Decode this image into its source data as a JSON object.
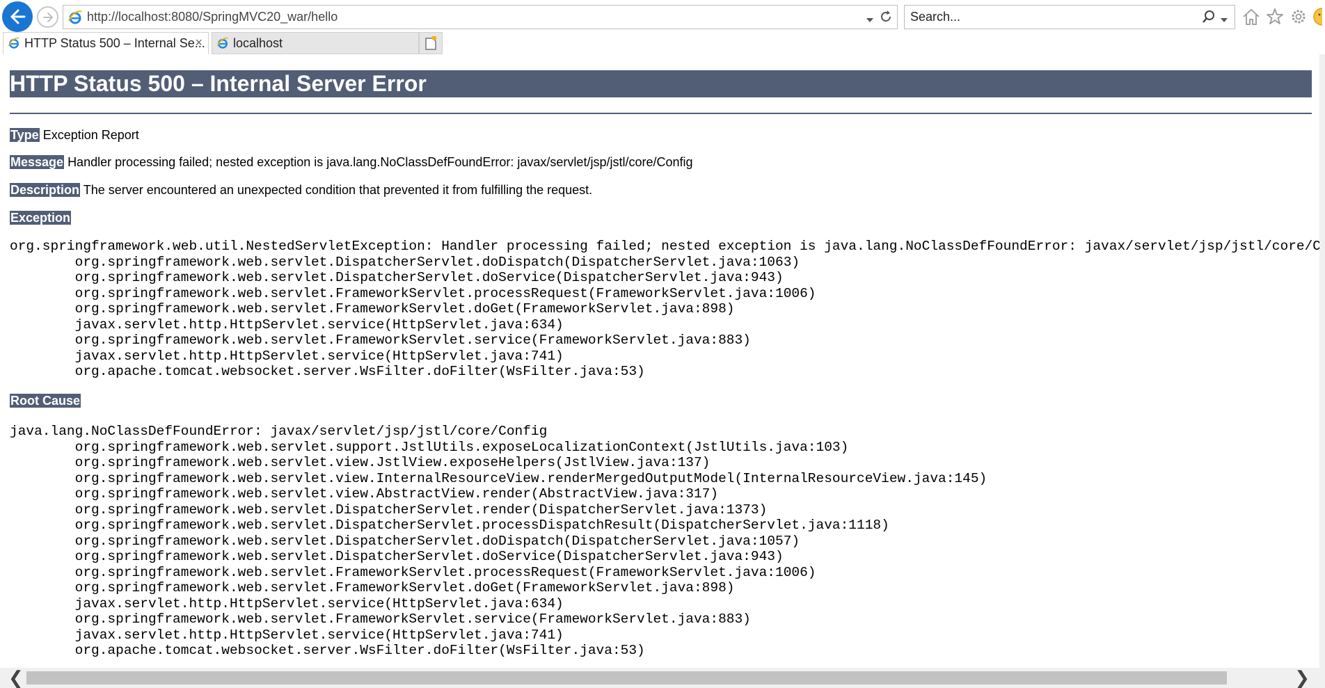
{
  "browser": {
    "url": "http://localhost:8080/SpringMVC20_war/hello",
    "search_placeholder": "Search...",
    "tabs": [
      {
        "label": "HTTP Status 500 – Internal Se...",
        "active": true
      },
      {
        "label": "localhost",
        "active": false
      }
    ],
    "tab_close": "×",
    "icons": [
      "back-arrow-icon",
      "forward-arrow-icon",
      "ie-logo-icon",
      "dropdown-icon",
      "refresh-icon",
      "search-icon",
      "home-icon",
      "favorites-star-icon",
      "settings-gear-icon",
      "smiley-feedback-icon",
      "new-tab-icon"
    ],
    "accent_color": "#1976d2"
  },
  "page": {
    "heading": "HTTP Status 500 – Internal Server Error",
    "header_color": "#525d76",
    "type": {
      "label": "Type",
      "value": "Exception Report"
    },
    "message": {
      "label": "Message",
      "value": "Handler processing failed; nested exception is java.lang.NoClassDefFoundError: javax/servlet/jsp/jstl/core/Config"
    },
    "description": {
      "label": "Description",
      "value": "The server encountered an unexpected condition that prevented it from fulfilling the request."
    },
    "exception": {
      "label": "Exception",
      "trace": "org.springframework.web.util.NestedServletException: Handler processing failed; nested exception is java.lang.NoClassDefFoundError: javax/servlet/jsp/jstl/core/Config\n\torg.springframework.web.servlet.DispatcherServlet.doDispatch(DispatcherServlet.java:1063)\n\torg.springframework.web.servlet.DispatcherServlet.doService(DispatcherServlet.java:943)\n\torg.springframework.web.servlet.FrameworkServlet.processRequest(FrameworkServlet.java:1006)\n\torg.springframework.web.servlet.FrameworkServlet.doGet(FrameworkServlet.java:898)\n\tjavax.servlet.http.HttpServlet.service(HttpServlet.java:634)\n\torg.springframework.web.servlet.FrameworkServlet.service(FrameworkServlet.java:883)\n\tjavax.servlet.http.HttpServlet.service(HttpServlet.java:741)\n\torg.apache.tomcat.websocket.server.WsFilter.doFilter(WsFilter.java:53)"
    },
    "root_cause": {
      "label": "Root Cause",
      "trace": "java.lang.NoClassDefFoundError: javax/servlet/jsp/jstl/core/Config\n\torg.springframework.web.servlet.support.JstlUtils.exposeLocalizationContext(JstlUtils.java:103)\n\torg.springframework.web.servlet.view.JstlView.exposeHelpers(JstlView.java:137)\n\torg.springframework.web.servlet.view.InternalResourceView.renderMergedOutputModel(InternalResourceView.java:145)\n\torg.springframework.web.servlet.view.AbstractView.render(AbstractView.java:317)\n\torg.springframework.web.servlet.DispatcherServlet.render(DispatcherServlet.java:1373)\n\torg.springframework.web.servlet.DispatcherServlet.processDispatchResult(DispatcherServlet.java:1118)\n\torg.springframework.web.servlet.DispatcherServlet.doDispatch(DispatcherServlet.java:1057)\n\torg.springframework.web.servlet.DispatcherServlet.doService(DispatcherServlet.java:943)\n\torg.springframework.web.servlet.FrameworkServlet.processRequest(FrameworkServlet.java:1006)\n\torg.springframework.web.servlet.FrameworkServlet.doGet(FrameworkServlet.java:898)\n\tjavax.servlet.http.HttpServlet.service(HttpServlet.java:634)\n\torg.springframework.web.servlet.FrameworkServlet.service(FrameworkServlet.java:883)\n\tjavax.servlet.http.HttpServlet.service(HttpServlet.java:741)\n\torg.apache.tomcat.websocket.server.WsFilter.doFilter(WsFilter.java:53)"
    }
  },
  "scrollbar": {
    "left_arrow": "❮",
    "right_arrow": "❯"
  }
}
